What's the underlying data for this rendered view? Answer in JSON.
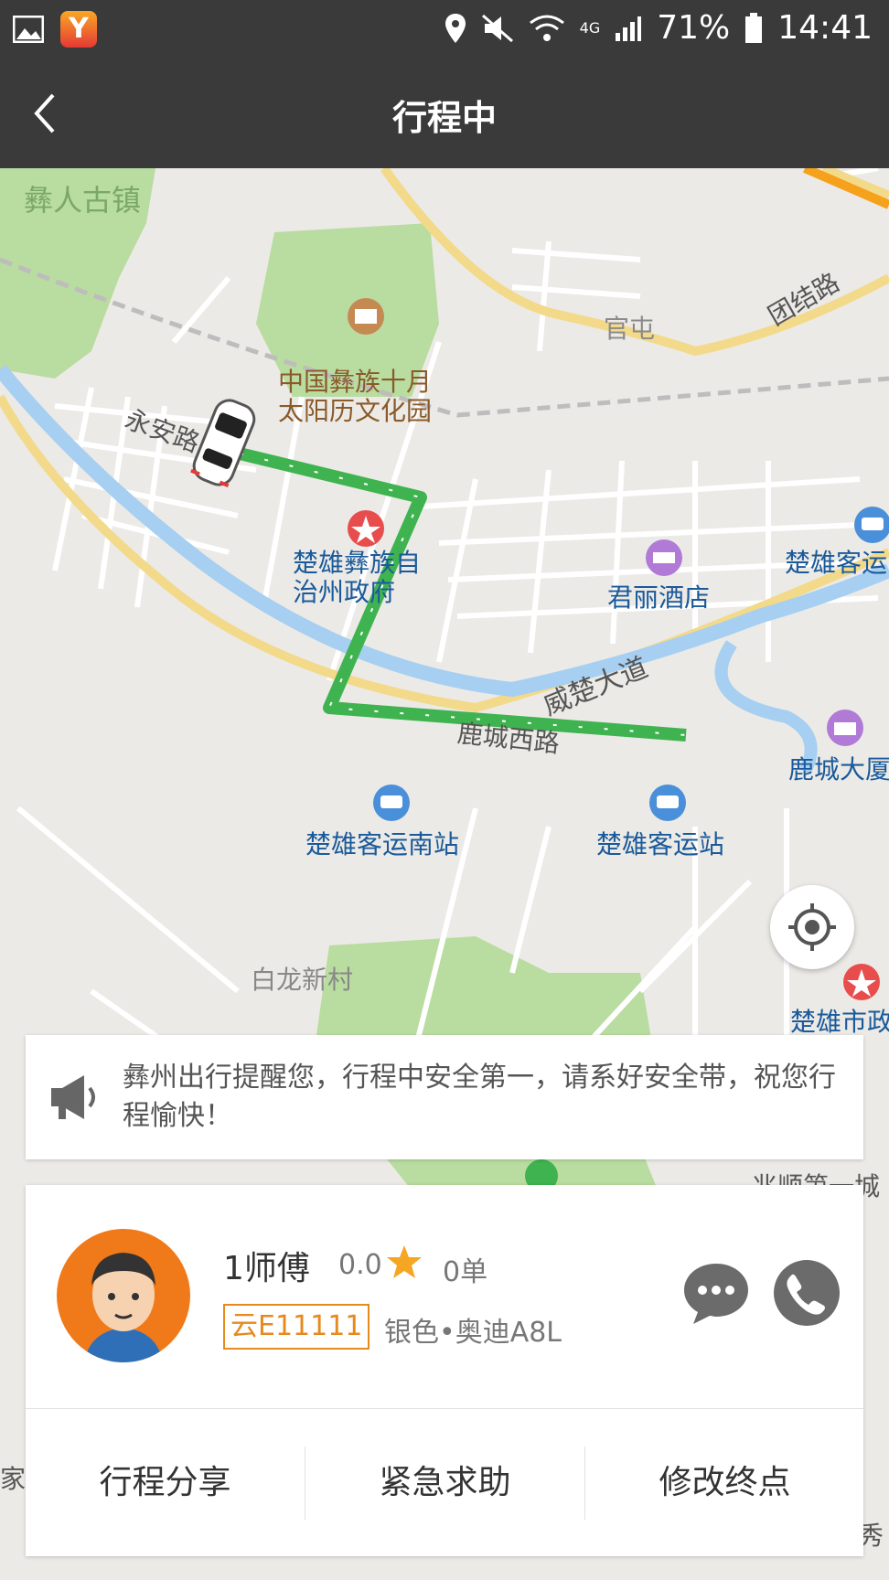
{
  "status_bar": {
    "battery": "71%",
    "time": "14:41",
    "network": "4G"
  },
  "header": {
    "title": "行程中"
  },
  "map": {
    "labels": {
      "old_town": "彝人古镇",
      "culture_park": "中国彝族十月\n太阳历文化园",
      "guantun": "官屯",
      "tuanjie_road": "团结路",
      "yongan_road": "永安路",
      "govt": "楚雄彝族自\n治州政府",
      "hotel": "君丽酒店",
      "bus_station_right": "楚雄客运",
      "weichu_avenue": "威楚大道",
      "lucheng_building": "鹿城大厦",
      "lucheng_west_road": "鹿城西路",
      "south_bus_station": "楚雄客运南站",
      "bus_station": "楚雄客运站",
      "bailong_village": "白龙新村",
      "city_govt": "楚雄市政",
      "zhaoshun": "兆顺第一城",
      "left_edge": "家",
      "right_edge": "秀"
    }
  },
  "notice": {
    "text": "彝州出行提醒您，行程中安全第一，请系好安全带，祝您行程愉快！"
  },
  "driver": {
    "name": "1师傅",
    "rating": "0.0",
    "orders": "0单",
    "plate": "云E11111",
    "car": "银色•奥迪A8L"
  },
  "actions": {
    "share": "行程分享",
    "sos": "紧急求助",
    "change_dest": "修改终点"
  },
  "icons": {
    "back": "back-arrow-icon",
    "locate": "locate-icon",
    "notice": "megaphone-icon",
    "chat": "chat-bubble-icon",
    "call": "phone-icon",
    "star": "star-icon"
  },
  "colors": {
    "header_bg": "#3a3a3a",
    "route": "#3fb34f",
    "plate": "#e68a1e",
    "star": "#f5a623",
    "avatar_bg": "#f07a1a"
  }
}
